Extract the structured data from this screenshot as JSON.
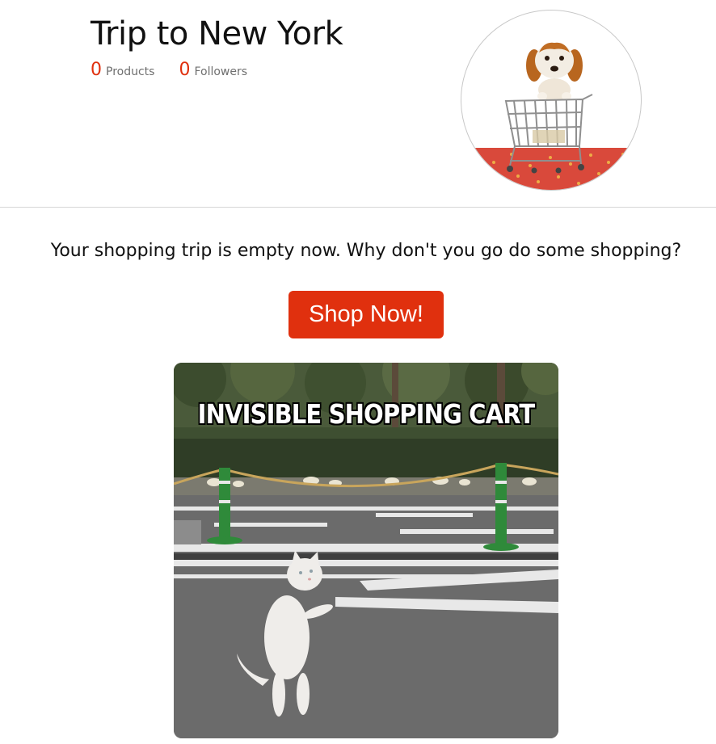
{
  "trip": {
    "title": "Trip to New York",
    "products_count": "0",
    "products_label": "Products",
    "followers_count": "0",
    "followers_label": "Followers",
    "avatar_icon": "puppy-in-shopping-cart-image"
  },
  "empty_state": {
    "message": "Your shopping trip is empty now. Why don't you go do some shopping?",
    "button_label": "Shop Now!"
  },
  "meme": {
    "caption": "INVISIBLE SHOPPING CART",
    "icon": "cat-standing-meme-image"
  },
  "colors": {
    "accent": "#e0300e",
    "divider": "#d6d6d6",
    "muted_text": "#6f6f6f"
  }
}
